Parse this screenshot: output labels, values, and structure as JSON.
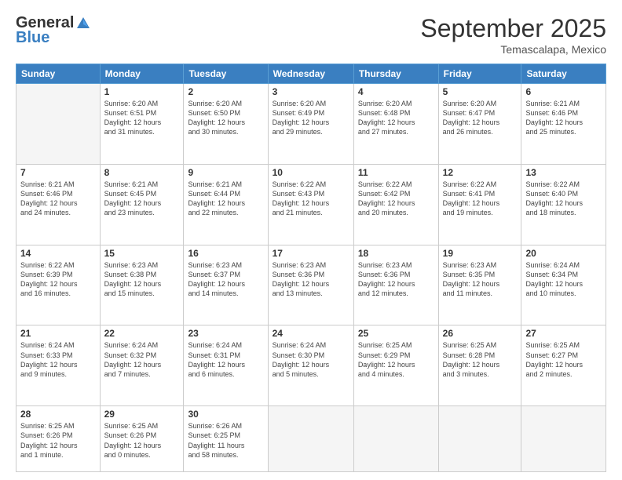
{
  "logo": {
    "general": "General",
    "blue": "Blue"
  },
  "title": "September 2025",
  "subtitle": "Temascalapa, Mexico",
  "days_of_week": [
    "Sunday",
    "Monday",
    "Tuesday",
    "Wednesday",
    "Thursday",
    "Friday",
    "Saturday"
  ],
  "weeks": [
    [
      {
        "day": "",
        "info": ""
      },
      {
        "day": "1",
        "info": "Sunrise: 6:20 AM\nSunset: 6:51 PM\nDaylight: 12 hours\nand 31 minutes."
      },
      {
        "day": "2",
        "info": "Sunrise: 6:20 AM\nSunset: 6:50 PM\nDaylight: 12 hours\nand 30 minutes."
      },
      {
        "day": "3",
        "info": "Sunrise: 6:20 AM\nSunset: 6:49 PM\nDaylight: 12 hours\nand 29 minutes."
      },
      {
        "day": "4",
        "info": "Sunrise: 6:20 AM\nSunset: 6:48 PM\nDaylight: 12 hours\nand 27 minutes."
      },
      {
        "day": "5",
        "info": "Sunrise: 6:20 AM\nSunset: 6:47 PM\nDaylight: 12 hours\nand 26 minutes."
      },
      {
        "day": "6",
        "info": "Sunrise: 6:21 AM\nSunset: 6:46 PM\nDaylight: 12 hours\nand 25 minutes."
      }
    ],
    [
      {
        "day": "7",
        "info": "Sunrise: 6:21 AM\nSunset: 6:46 PM\nDaylight: 12 hours\nand 24 minutes."
      },
      {
        "day": "8",
        "info": "Sunrise: 6:21 AM\nSunset: 6:45 PM\nDaylight: 12 hours\nand 23 minutes."
      },
      {
        "day": "9",
        "info": "Sunrise: 6:21 AM\nSunset: 6:44 PM\nDaylight: 12 hours\nand 22 minutes."
      },
      {
        "day": "10",
        "info": "Sunrise: 6:22 AM\nSunset: 6:43 PM\nDaylight: 12 hours\nand 21 minutes."
      },
      {
        "day": "11",
        "info": "Sunrise: 6:22 AM\nSunset: 6:42 PM\nDaylight: 12 hours\nand 20 minutes."
      },
      {
        "day": "12",
        "info": "Sunrise: 6:22 AM\nSunset: 6:41 PM\nDaylight: 12 hours\nand 19 minutes."
      },
      {
        "day": "13",
        "info": "Sunrise: 6:22 AM\nSunset: 6:40 PM\nDaylight: 12 hours\nand 18 minutes."
      }
    ],
    [
      {
        "day": "14",
        "info": "Sunrise: 6:22 AM\nSunset: 6:39 PM\nDaylight: 12 hours\nand 16 minutes."
      },
      {
        "day": "15",
        "info": "Sunrise: 6:23 AM\nSunset: 6:38 PM\nDaylight: 12 hours\nand 15 minutes."
      },
      {
        "day": "16",
        "info": "Sunrise: 6:23 AM\nSunset: 6:37 PM\nDaylight: 12 hours\nand 14 minutes."
      },
      {
        "day": "17",
        "info": "Sunrise: 6:23 AM\nSunset: 6:36 PM\nDaylight: 12 hours\nand 13 minutes."
      },
      {
        "day": "18",
        "info": "Sunrise: 6:23 AM\nSunset: 6:36 PM\nDaylight: 12 hours\nand 12 minutes."
      },
      {
        "day": "19",
        "info": "Sunrise: 6:23 AM\nSunset: 6:35 PM\nDaylight: 12 hours\nand 11 minutes."
      },
      {
        "day": "20",
        "info": "Sunrise: 6:24 AM\nSunset: 6:34 PM\nDaylight: 12 hours\nand 10 minutes."
      }
    ],
    [
      {
        "day": "21",
        "info": "Sunrise: 6:24 AM\nSunset: 6:33 PM\nDaylight: 12 hours\nand 9 minutes."
      },
      {
        "day": "22",
        "info": "Sunrise: 6:24 AM\nSunset: 6:32 PM\nDaylight: 12 hours\nand 7 minutes."
      },
      {
        "day": "23",
        "info": "Sunrise: 6:24 AM\nSunset: 6:31 PM\nDaylight: 12 hours\nand 6 minutes."
      },
      {
        "day": "24",
        "info": "Sunrise: 6:24 AM\nSunset: 6:30 PM\nDaylight: 12 hours\nand 5 minutes."
      },
      {
        "day": "25",
        "info": "Sunrise: 6:25 AM\nSunset: 6:29 PM\nDaylight: 12 hours\nand 4 minutes."
      },
      {
        "day": "26",
        "info": "Sunrise: 6:25 AM\nSunset: 6:28 PM\nDaylight: 12 hours\nand 3 minutes."
      },
      {
        "day": "27",
        "info": "Sunrise: 6:25 AM\nSunset: 6:27 PM\nDaylight: 12 hours\nand 2 minutes."
      }
    ],
    [
      {
        "day": "28",
        "info": "Sunrise: 6:25 AM\nSunset: 6:26 PM\nDaylight: 12 hours\nand 1 minute."
      },
      {
        "day": "29",
        "info": "Sunrise: 6:25 AM\nSunset: 6:26 PM\nDaylight: 12 hours\nand 0 minutes."
      },
      {
        "day": "30",
        "info": "Sunrise: 6:26 AM\nSunset: 6:25 PM\nDaylight: 11 hours\nand 58 minutes."
      },
      {
        "day": "",
        "info": ""
      },
      {
        "day": "",
        "info": ""
      },
      {
        "day": "",
        "info": ""
      },
      {
        "day": "",
        "info": ""
      }
    ]
  ]
}
